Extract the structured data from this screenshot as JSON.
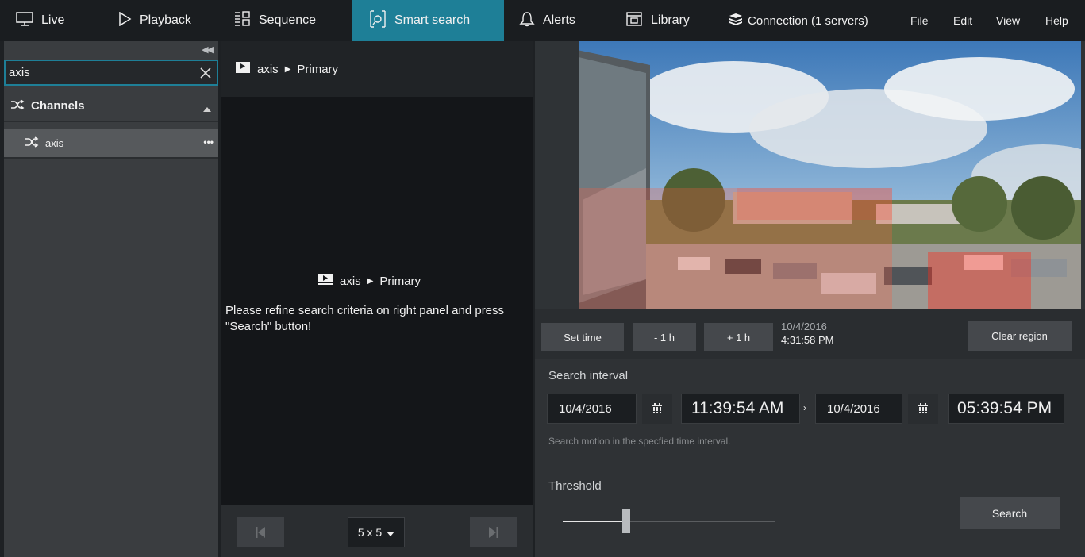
{
  "nav": {
    "tabs": [
      {
        "label": "Live",
        "icon": "monitor-icon"
      },
      {
        "label": "Playback",
        "icon": "play-icon"
      },
      {
        "label": "Sequence",
        "icon": "grid-icon"
      },
      {
        "label": "Smart search",
        "icon": "smart-search-icon",
        "active": true
      },
      {
        "label": "Alerts",
        "icon": "bell-icon"
      },
      {
        "label": "Library",
        "icon": "library-icon"
      }
    ],
    "connection": "Connection (1 servers)",
    "menu": [
      "File",
      "Edit",
      "View",
      "Help"
    ],
    "accent_color": "#1e7f97"
  },
  "sidebar": {
    "search_value": "axis",
    "section_label": "Channels",
    "channels": [
      {
        "label": "axis"
      }
    ]
  },
  "middle": {
    "header_channel": "axis",
    "header_stream": "Primary",
    "sub_channel": "axis",
    "sub_stream": "Primary",
    "message": "Please refine search criteria on right panel and press \"Search\" button!",
    "grid_size": "5 x 5"
  },
  "right": {
    "set_time_label": "Set time",
    "minus_label": "- 1 h",
    "plus_label": "+ 1 h",
    "timestamp_date": "10/4/2016",
    "timestamp_time": "4:31:58 PM",
    "clear_region_label": "Clear region",
    "interval_label": "Search interval",
    "start_date": "10/4/2016",
    "start_time": "11:39:54 AM",
    "end_date": "10/4/2016",
    "end_time": "05:39:54 PM",
    "hint": "Search motion in the specfied time interval.",
    "threshold_label": "Threshold",
    "threshold_level": 0.3,
    "search_label": "Search"
  }
}
